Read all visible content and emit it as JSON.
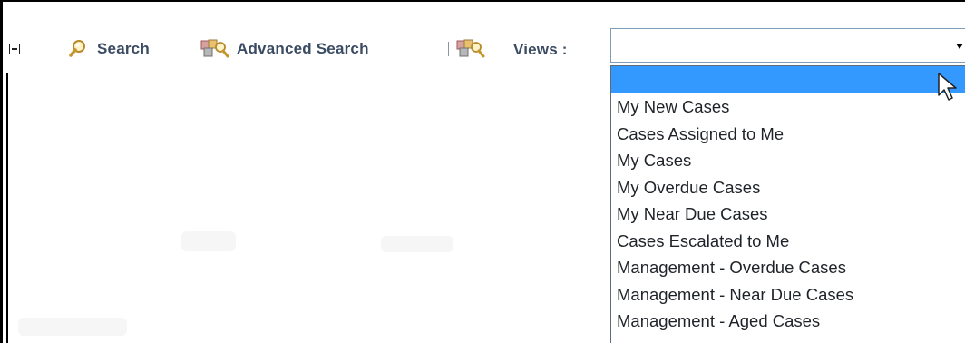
{
  "toolbar": {
    "search_label": "Search",
    "advanced_search_label": "Advanced Search",
    "views_label": "Views :",
    "icons": [
      "collapse-minus-icon",
      "magnifier-icon",
      "advanced-search-icon",
      "views-icon"
    ]
  },
  "views_dropdown": {
    "selected_value": "",
    "options": [
      "",
      "My New Cases",
      "Cases Assigned to Me",
      "My Cases",
      "My Overdue Cases",
      "My Near Due Cases",
      "Cases Escalated to Me",
      "Management - Overdue Cases",
      "Management - Near Due Cases",
      "Management - Aged Cases"
    ],
    "highlight_color": "#3399ff"
  },
  "colors": {
    "toolbar_text": "#3b4b63",
    "select_border": "#7f9db9"
  }
}
